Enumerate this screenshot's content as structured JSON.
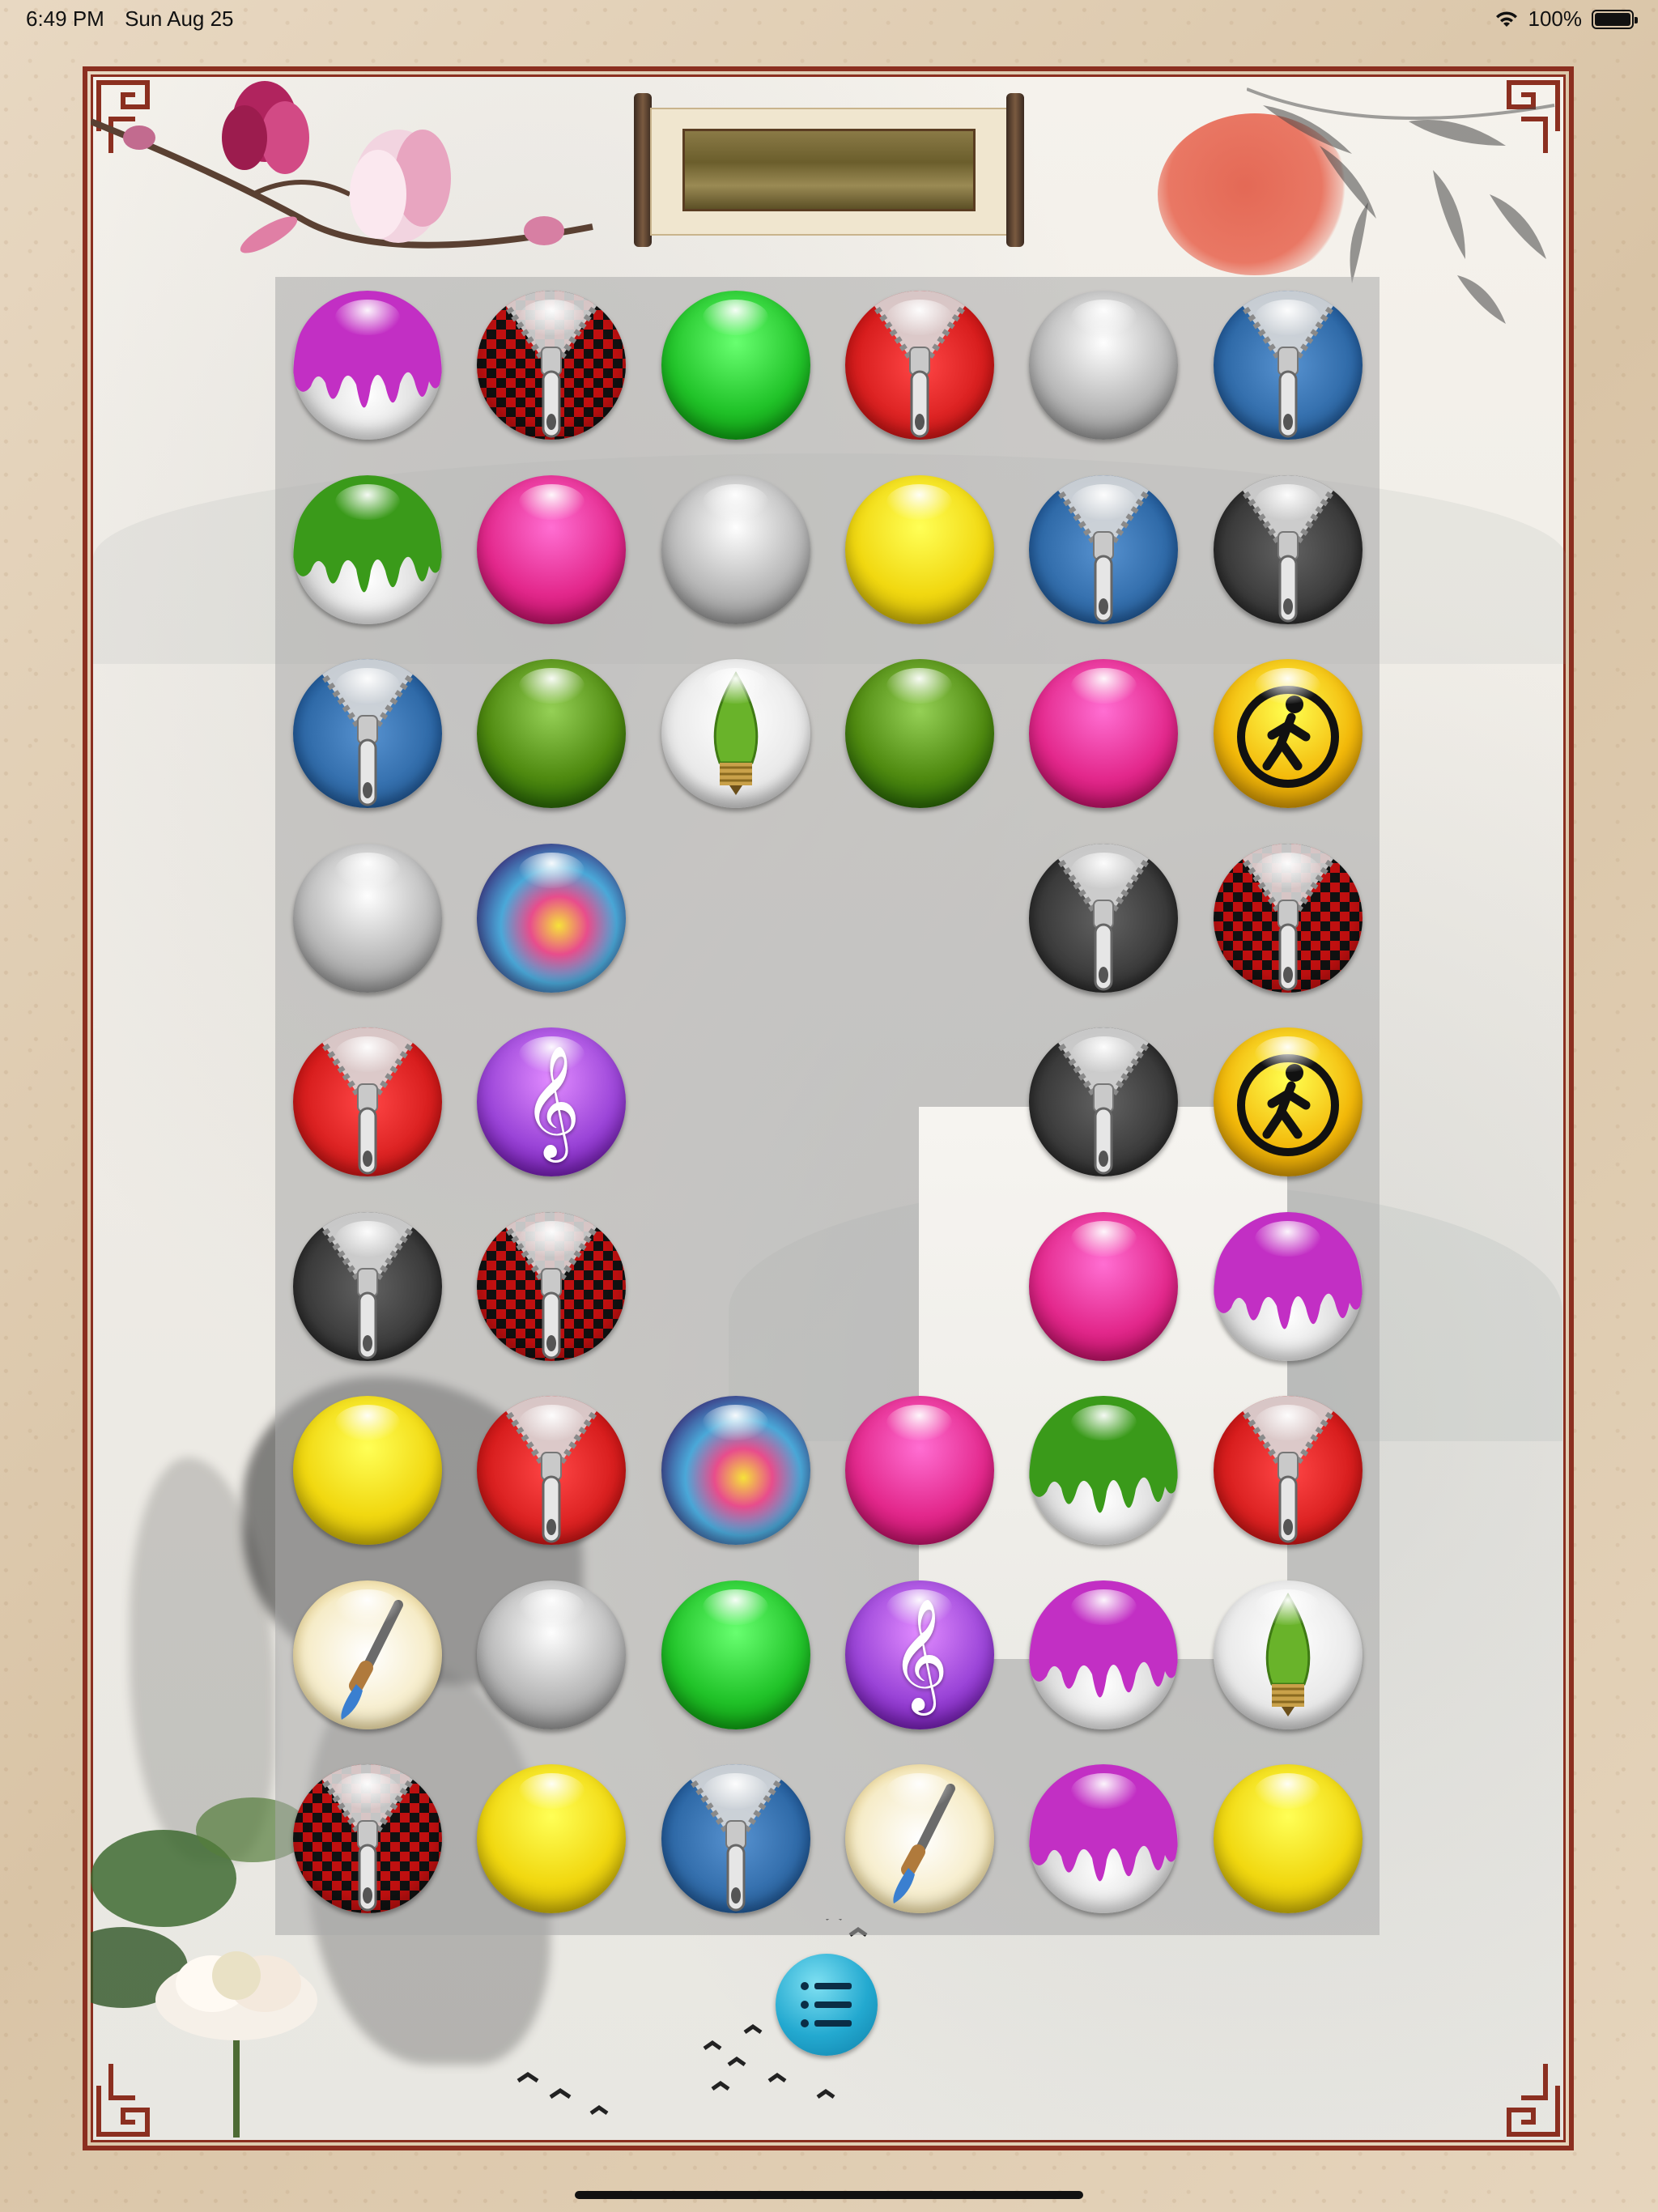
{
  "status_bar": {
    "time": "6:49 PM",
    "date": "Sun Aug 25",
    "battery": "100%"
  },
  "board": {
    "rows": 9,
    "cols": 6,
    "empty_region": "center rows 4-6, columns 3-4",
    "cells": [
      [
        "drip-magenta",
        "zipper-checker",
        "glass-green",
        "zipper-red",
        "glass-silver",
        "zipper-denim"
      ],
      [
        "drip-green",
        "glass-pink",
        "glass-silver",
        "glass-yellow",
        "zipper-denim",
        "zipper-black"
      ],
      [
        "zipper-denim",
        "glass-olive",
        "bulb",
        "glass-olive",
        "glass-pink",
        "walker-sign"
      ],
      [
        "glass-silver",
        "nebula",
        null,
        null,
        "zipper-black",
        "zipper-checker"
      ],
      [
        "zipper-red",
        "music-note",
        null,
        null,
        "zipper-black",
        "walker-sign"
      ],
      [
        "zipper-black",
        "zipper-checker",
        null,
        null,
        "glass-pink",
        "drip-magenta"
      ],
      [
        "glass-yellow",
        "zipper-red",
        "nebula",
        "glass-pink",
        "drip-green",
        "zipper-red"
      ],
      [
        "paintbrush",
        "glass-silver",
        "glass-green",
        "music-note",
        "drip-magenta",
        "bulb"
      ],
      [
        "zipper-checker",
        "glass-yellow",
        "zipper-denim",
        "paintbrush",
        "drip-magenta",
        "glass-yellow"
      ]
    ]
  },
  "ball_colors": {
    "glass-green": "#22c42a",
    "glass-pink": "#e3288c",
    "glass-silver": "#b8b8b8",
    "glass-yellow": "#f1d810",
    "glass-olive": "#4f8a10",
    "drip-magenta": "#c22fc4",
    "drip-green": "#3a9a1a",
    "zipper-red": "#d81e1e",
    "zipper-denim": "#2f6aa8",
    "zipper-black": "#3a3a3a",
    "zipper-checker": "#c01010",
    "walker-sign": "#f3b90a",
    "music-note": "#9b45d8",
    "bulb": "#eaeaea",
    "nebula": "#5a4fa0",
    "paintbrush": "#f5e7b5"
  },
  "menu_button": {
    "icon": "list-icon",
    "color": "#23a9d0"
  },
  "frame_color": "#8b2f20"
}
